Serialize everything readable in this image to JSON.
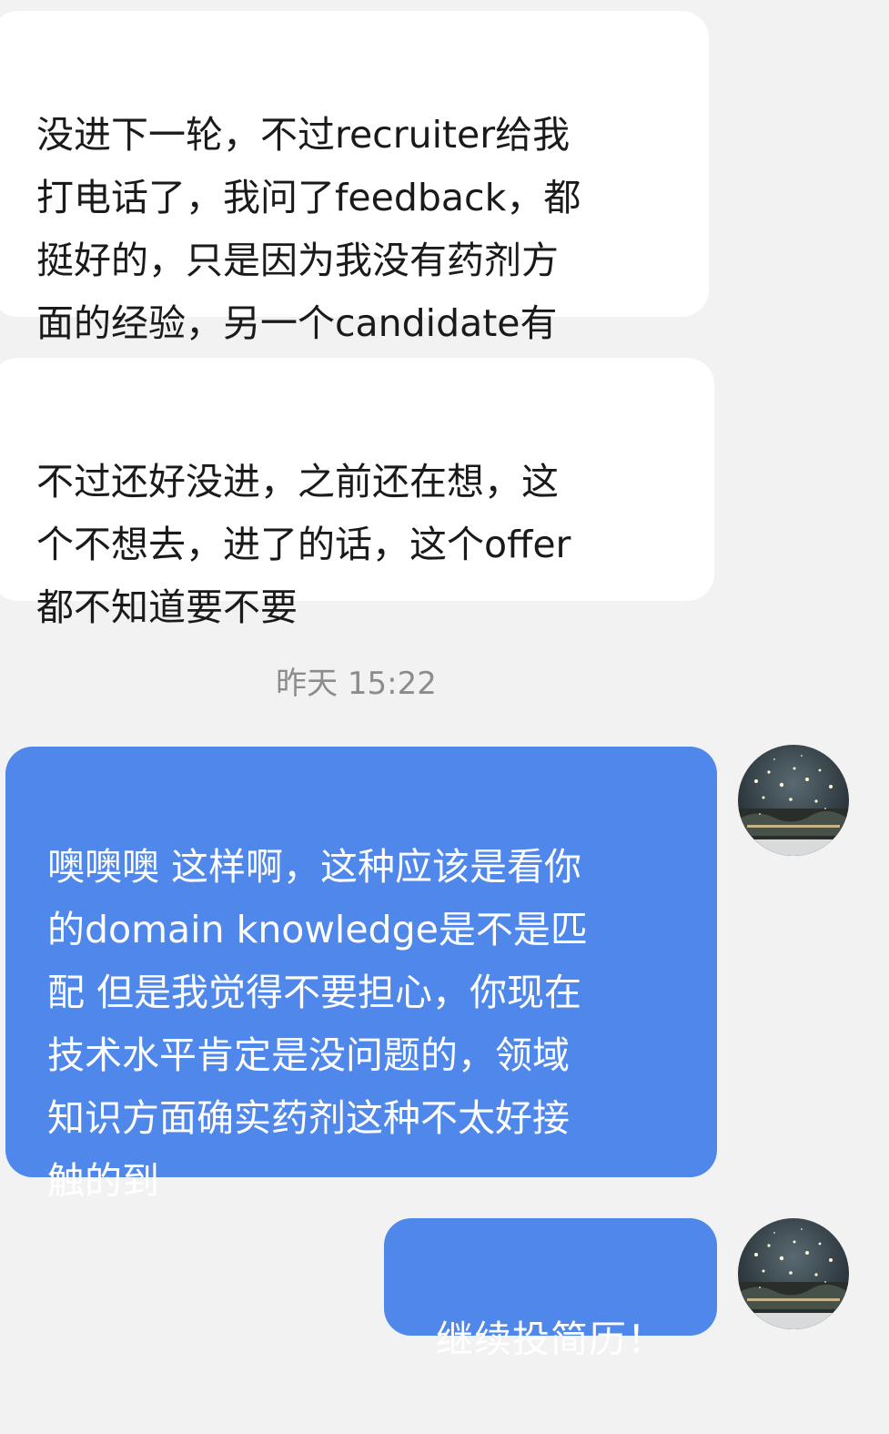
{
  "messages": [
    {
      "direction": "incoming",
      "text": "没进下一轮，不过recruiter给我\n打电话了，我问了feedback，都\n挺好的，只是因为我没有药剂方\n面的经验，另一个candidate有"
    },
    {
      "direction": "incoming",
      "text": "不过还好没进，之前还在想，这\n个不想去，进了的话，这个offer\n都不知道要不要"
    },
    {
      "direction": "outgoing",
      "text": "噢噢噢 这样啊，这种应该是看你\n的domain knowledge是不是匹\n配 但是我觉得不要担心，你现在\n技术水平肯定是没问题的，领域\n知识方面确实药剂这种不太好接\n触的到"
    },
    {
      "direction": "outgoing",
      "text": "继续投简历！"
    }
  ],
  "timestamp": "昨天 15:22",
  "colors": {
    "background": "#f2f2f2",
    "incoming_bubble": "#ffffff",
    "outgoing_bubble": "#4f88ea",
    "timestamp_text": "#8c8c8c"
  },
  "avatar": {
    "icon": "user-avatar-night-lights-icon"
  }
}
